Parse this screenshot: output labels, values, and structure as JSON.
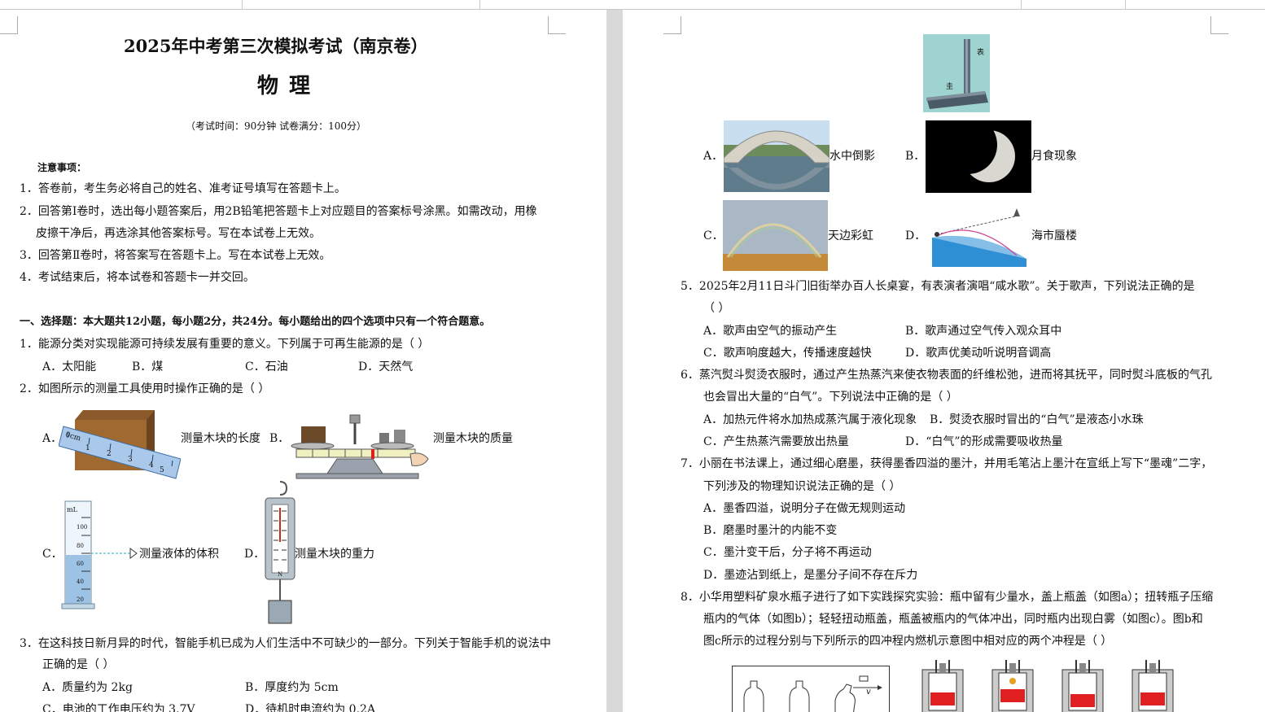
{
  "header": {
    "title": "2025年中考第三次模拟考试（南京卷）",
    "subject": "物  理",
    "exam_info": "（考试时间：90分钟   试卷满分：100分）"
  },
  "notice": {
    "heading": "注意事项：",
    "items": [
      "1．答卷前，考生务必将自己的姓名、准考证号填写在答题卡上。",
      "2．回答第Ⅰ卷时，选出每小题答案后，用2B铅笔把答题卡上对应题目的答案标号涂黑。如需改动，用橡",
      "皮擦干净后，再选涂其他答案标号。写在本试卷上无效。",
      "3．回答第Ⅱ卷时，将答案写在答题卡上。写在本试卷上无效。",
      "4．考试结束后，将本试卷和答题卡一并交回。"
    ]
  },
  "section1": {
    "heading": "一、选择题：本大题共12小题，每小题2分，共24分。每小题给出的四个选项中只有一个符合题意。"
  },
  "q1": {
    "stem": "1．能源分类对实现能源可持续发展有重要的意义。下列属于可再生能源的是（        ）",
    "a": "A．太阳能",
    "b": "B．煤",
    "c": "C．石油",
    "d": "D．天然气"
  },
  "q2": {
    "stem": "2．如图所示的测量工具使用时操作正确的是（        ）",
    "a_letter": "A．",
    "a_text": "测量木块的长度",
    "b_letter": "B．",
    "b_text": "测量木块的质量",
    "c_letter": "C．",
    "c_text": "测量液体的体积",
    "d_letter": "D．",
    "d_text": "测量木块的重力",
    "ruler_label": "0cm",
    "ruler_nums": [
      "1",
      "2",
      "3",
      "4",
      "5"
    ],
    "cylinder_unit": "mL",
    "cylinder_marks": [
      "100",
      "80",
      "60",
      "40",
      "20"
    ],
    "scale_unit": "N"
  },
  "q3": {
    "stem": "3．在这科技日新月异的时代，智能手机已成为人们生活中不可缺少的一部分。下列关于智能手机的说法中",
    "stem2": "正确的是（        ）",
    "a": "A．质量约为 2kg",
    "b": "B．厚度约为 5cm",
    "c": "C．电池的工作电压约为 3.7V",
    "d": "D．待机时电流约为 0.2A"
  },
  "q4": {
    "gnomon_label_biao": "表",
    "gnomon_label_gui": "圭",
    "a_letter": "A．",
    "a_text": "水中倒影",
    "b_letter": "B．",
    "b_text": "月食现象",
    "c_letter": "C．",
    "c_text": "天边彩虹",
    "d_letter": "D．",
    "d_text": "海市蜃楼"
  },
  "q5": {
    "stem": "5．2025年2月11日斗门旧街举办百人长桌宴，有表演者演唱“咸水歌”。关于歌声，下列说法正确的是",
    "stem2": "（        ）",
    "a": "A．歌声由空气的振动产生",
    "b": "B．歌声通过空气传入观众耳中",
    "c": "C．歌声响度越大，传播速度越快",
    "d": "D．歌声优美动听说明音调高"
  },
  "q6": {
    "stem": "6．蒸汽熨斗熨烫衣服时，通过产生热蒸汽来使衣物表面的纤维松弛，进而将其抚平，同时熨斗底板的气孔",
    "stem2": "也会冒出大量的“白气”。下列说法中正确的是（    ）",
    "a": "A．加热元件将水加热成蒸汽属于液化现象",
    "b": "B．熨烫衣服时冒出的“白气”是液态小水珠",
    "c": "C．产生热蒸汽需要放出热量",
    "d": "D．“白气”的形成需要吸收热量"
  },
  "q7": {
    "stem": "7．小丽在书法课上，通过细心磨墨，获得墨香四溢的墨汁，并用毛笔沾上墨汁在宣纸上写下“墨魂”二字，",
    "stem2": "下列涉及的物理知识说法正确的是（        ）",
    "a": "A．墨香四溢，说明分子在做无规则运动",
    "b": "B．磨墨时墨汁的内能不变",
    "c": "C．墨汁变干后，分子将不再运动",
    "d": "D．墨迹沾到纸上，是墨分子间不存在斥力"
  },
  "q8": {
    "stem": "8．小华用塑料矿泉水瓶子进行了如下实践探究实验：瓶中留有少量水，盖上瓶盖（如图a）；扭转瓶子压缩",
    "stem2": "瓶内的气体（如图b）；轻轻扭动瓶盖，瓶盖被瓶内的气体冲出，同时瓶内出现白雾（如图c）。图b和",
    "stem3": "图c所示的过程分别与下列所示的四冲程内燃机示意图中相对应的两个冲程是（        ）",
    "v_label": "v"
  },
  "colors": {
    "background": "#d9d9d9",
    "page": "#ffffff",
    "liquid": "#9cc3e6",
    "sea": "#2f8fd4",
    "piston_red": "#e02020"
  }
}
